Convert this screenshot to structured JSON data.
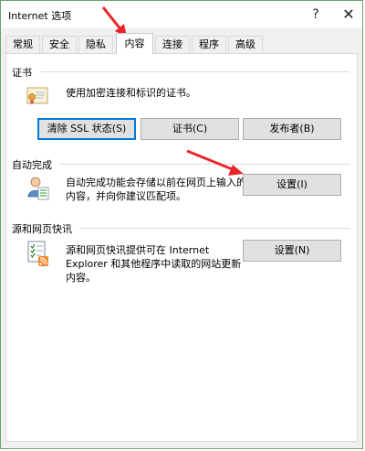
{
  "window": {
    "title": "Internet 选项",
    "help_glyph": "?",
    "close_glyph": "✕"
  },
  "tabs": [
    {
      "label": "常规"
    },
    {
      "label": "安全"
    },
    {
      "label": "隐私"
    },
    {
      "label": "内容",
      "active": true
    },
    {
      "label": "连接"
    },
    {
      "label": "程序"
    },
    {
      "label": "高级"
    }
  ],
  "certificates": {
    "title": "证书",
    "description": "使用加密连接和标识的证书。",
    "buttons": {
      "clear_ssl": "清除 SSL 状态(S)",
      "certificates": "证书(C)",
      "publishers": "发布者(B)"
    }
  },
  "autocomplete": {
    "title": "自动完成",
    "description_lines": [
      "自动完成功能会存储以前在网页上输入的",
      "内容，并向你建议匹配项。"
    ],
    "settings_button": "设置(I)"
  },
  "feeds": {
    "title": "源和网页快讯",
    "description_lines": [
      "源和网页快讯提供可在 Internet",
      "Explorer 和其他程序中读取的网站更新",
      "内容。"
    ],
    "settings_button": "设置(N)"
  },
  "colors": {
    "accent_focus": "#0078d7",
    "annotation_arrow": "#e8252b",
    "window_border": "#6aa36a"
  },
  "icons": [
    "certificate-icon",
    "autocomplete-person-icon",
    "feeds-rss-icon"
  ]
}
